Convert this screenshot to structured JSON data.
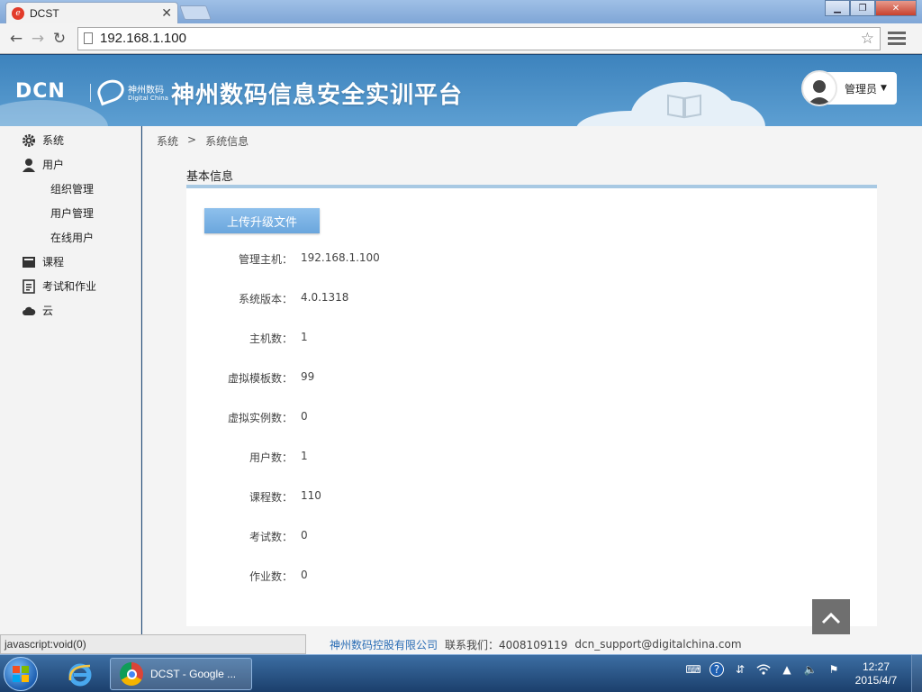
{
  "browser": {
    "tab_title": "DCST",
    "url": "192.168.1.100"
  },
  "header": {
    "logo_text": "DCN",
    "brand_cn": "神州数码",
    "brand_en": "Digital China",
    "platform_title": "神州数码信息安全实训平台",
    "user_name": "管理员"
  },
  "sidebar": {
    "items": [
      {
        "label": "系统",
        "icon": "gear-icon"
      },
      {
        "label": "用户",
        "icon": "user-icon"
      },
      {
        "label": "组织管理"
      },
      {
        "label": "用户管理"
      },
      {
        "label": "在线用户"
      },
      {
        "label": "课程",
        "icon": "course-icon"
      },
      {
        "label": "考试和作业",
        "icon": "exam-icon"
      },
      {
        "label": "云",
        "icon": "cloud-icon"
      }
    ]
  },
  "breadcrumb": {
    "root": "系统",
    "separator": ">",
    "current": "系统信息"
  },
  "main": {
    "section_title": "基本信息",
    "upload_button": "上传升级文件",
    "info": [
      {
        "label": "管理主机：",
        "value": "192.168.1.100"
      },
      {
        "label": "系统版本：",
        "value": "4.0.1318"
      },
      {
        "label": "主机数：",
        "value": "1"
      },
      {
        "label": "虚拟模板数：",
        "value": "99"
      },
      {
        "label": "虚拟实例数：",
        "value": "0"
      },
      {
        "label": "用户数：",
        "value": "1"
      },
      {
        "label": "课程数：",
        "value": "110"
      },
      {
        "label": "考试数：",
        "value": "0"
      },
      {
        "label": "作业数：",
        "value": "0"
      }
    ]
  },
  "footer": {
    "company": "神州数码控股有限公司",
    "contact": "联系我们：4008109119",
    "email": "dcn_support@digitalchina.com"
  },
  "statusbar": {
    "text": "javascript:void(0)"
  },
  "taskbar": {
    "chrome_label": "DCST - Google ...",
    "time": "12:27",
    "date": "2015/4/7"
  },
  "colors": {
    "header_blue": "#4a90c8",
    "panel_accent": "#a8c9e3",
    "button_blue": "#7ab3e4",
    "link_blue": "#2a6db5"
  }
}
